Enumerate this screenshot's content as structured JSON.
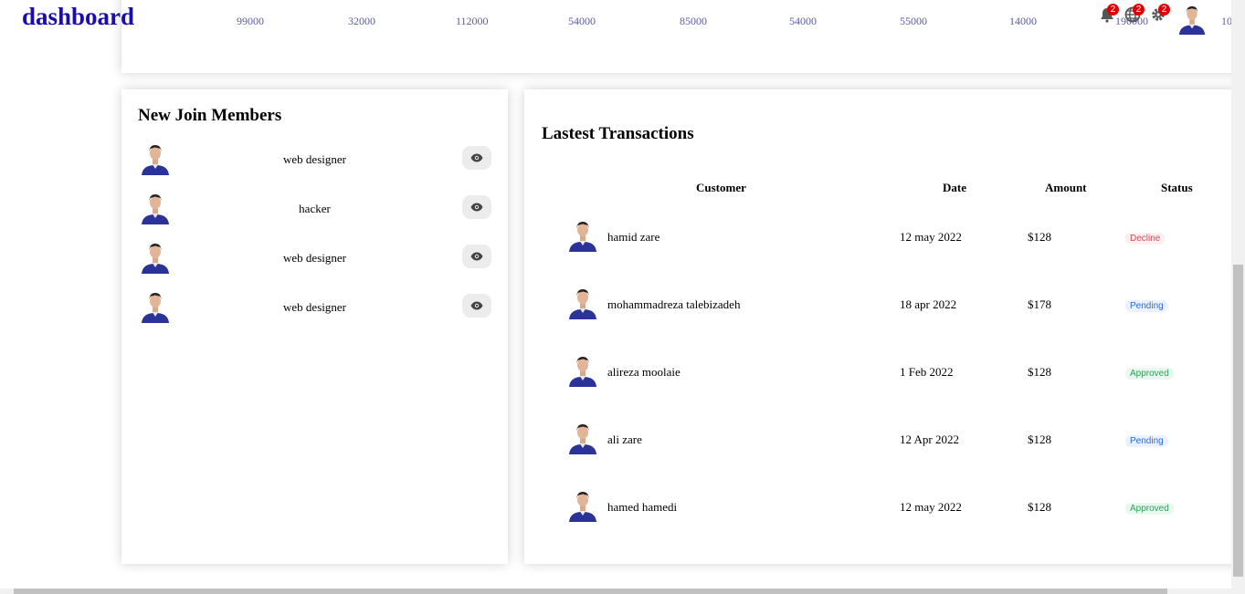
{
  "app": {
    "title": "dashboard"
  },
  "topbar": {
    "icons": [
      {
        "name": "bell-icon",
        "badge": "2"
      },
      {
        "name": "globe-icon",
        "badge": "2"
      },
      {
        "name": "gear-icon",
        "badge": "2"
      }
    ]
  },
  "chart": {
    "x_ticks": [
      "99000",
      "32000",
      "112000",
      "54000",
      "85000",
      "54000",
      "55000",
      "14000",
      "190000",
      "10"
    ]
  },
  "members": {
    "title": "New Join Members",
    "items": [
      {
        "role": "web designer"
      },
      {
        "role": "hacker"
      },
      {
        "role": "web designer"
      },
      {
        "role": "web designer"
      }
    ]
  },
  "transactions": {
    "title": "Lastest Transactions",
    "headers": {
      "customer": "Customer",
      "date": "Date",
      "amount": "Amount",
      "status": "Status"
    },
    "rows": [
      {
        "customer": "hamid zare",
        "date": "12 may 2022",
        "amount": "$128",
        "status": "Decline"
      },
      {
        "customer": "mohammadreza talebizadeh",
        "date": "18 apr 2022",
        "amount": "$178",
        "status": "Pending"
      },
      {
        "customer": "alireza moolaie",
        "date": "1 Feb 2022",
        "amount": "$128",
        "status": "Approved"
      },
      {
        "customer": "ali zare",
        "date": "12 Apr 2022",
        "amount": "$128",
        "status": "Pending"
      },
      {
        "customer": "hamed hamedi",
        "date": "12 may 2022",
        "amount": "$128",
        "status": "Approved"
      }
    ]
  },
  "colors": {
    "title": "#1a0dab",
    "badge": "#e10000",
    "decline": "#d9455b",
    "pending": "#2a6be0",
    "approved": "#2b9e57"
  }
}
